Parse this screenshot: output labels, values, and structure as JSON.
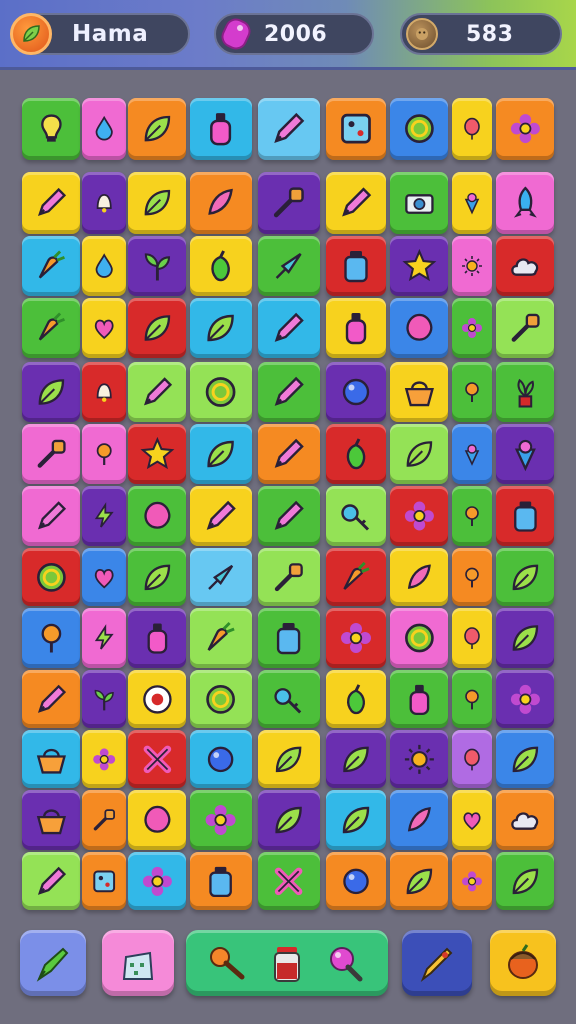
{
  "header": {
    "title": "Hama",
    "gems": "2006",
    "coins": "583",
    "colors": {
      "leaf_badge": "#f07a2a",
      "gem_badge": "#e04ad0",
      "coin_badge": "#8b6a40"
    }
  },
  "board": {
    "rows": [
      [
        [
          "green",
          "lightbulb"
        ],
        [
          "pink",
          "drop"
        ],
        [
          "orange",
          "leaf"
        ],
        [
          "cyan",
          "bottle"
        ],
        [
          "sky",
          "pencil"
        ],
        [
          "orange",
          "box"
        ],
        [
          "blue",
          "ring"
        ],
        [
          "yellow",
          "balloon"
        ],
        [
          "orange",
          "flower"
        ]
      ],
      [
        [
          "yellow",
          "pencil"
        ],
        [
          "purple",
          "bell"
        ],
        [
          "yellow",
          "leaf"
        ],
        [
          "orange",
          "feather"
        ],
        [
          "purple",
          "tool"
        ],
        [
          "yellow",
          "pencil"
        ],
        [
          "green",
          "camera"
        ],
        [
          "yellow",
          "cone"
        ],
        [
          "pink",
          "rocket"
        ]
      ],
      [
        [
          "cyan",
          "carrot"
        ],
        [
          "yellow",
          "drop"
        ],
        [
          "purple",
          "sprout"
        ],
        [
          "yellow",
          "pepper"
        ],
        [
          "green",
          "arrow"
        ],
        [
          "red",
          "jar"
        ],
        [
          "purple",
          "star"
        ],
        [
          "pink",
          "sun"
        ],
        [
          "red",
          "cloud"
        ]
      ],
      [
        [
          "green",
          "carrot"
        ],
        [
          "yellow",
          "heart"
        ],
        [
          "red",
          "leaf"
        ],
        [
          "cyan",
          "leaf"
        ],
        [
          "cyan",
          "pencil"
        ],
        [
          "yellow",
          "bottle"
        ],
        [
          "blue",
          "blob"
        ],
        [
          "green",
          "flower"
        ],
        [
          "lime",
          "tool"
        ]
      ],
      [
        [
          "purple",
          "leaf"
        ],
        [
          "red",
          "bell"
        ],
        [
          "lime",
          "pencil"
        ],
        [
          "lime",
          "ring"
        ],
        [
          "green",
          "pencil"
        ],
        [
          "purple",
          "ball"
        ],
        [
          "yellow",
          "basket"
        ],
        [
          "green",
          "pin"
        ],
        [
          "green",
          "plant"
        ]
      ],
      [
        [
          "pink",
          "tool"
        ],
        [
          "pink",
          "pin"
        ],
        [
          "red",
          "star"
        ],
        [
          "cyan",
          "leaf"
        ],
        [
          "orange",
          "pencil"
        ],
        [
          "red",
          "pepper"
        ],
        [
          "lime",
          "leaf"
        ],
        [
          "blue",
          "cone"
        ],
        [
          "purple",
          "cone"
        ]
      ],
      [
        [
          "pink",
          "pencil"
        ],
        [
          "purple",
          "bolt"
        ],
        [
          "green",
          "blob"
        ],
        [
          "yellow",
          "pencil"
        ],
        [
          "green",
          "pencil"
        ],
        [
          "lime",
          "key"
        ],
        [
          "red",
          "flower"
        ],
        [
          "green",
          "pin"
        ],
        [
          "red",
          "jar"
        ]
      ],
      [
        [
          "red",
          "ring"
        ],
        [
          "blue",
          "heart"
        ],
        [
          "green",
          "leaf"
        ],
        [
          "sky",
          "arrow"
        ],
        [
          "lime",
          "tool"
        ],
        [
          "red",
          "carrot"
        ],
        [
          "yellow",
          "feather"
        ],
        [
          "orange",
          "pin"
        ],
        [
          "green",
          "leaf"
        ]
      ],
      [
        [
          "blue",
          "pin"
        ],
        [
          "pink",
          "bolt"
        ],
        [
          "purple",
          "bottle"
        ],
        [
          "lime",
          "carrot"
        ],
        [
          "green",
          "jar"
        ],
        [
          "red",
          "flower"
        ],
        [
          "pink",
          "ring"
        ],
        [
          "yellow",
          "balloon"
        ],
        [
          "purple",
          "leaf"
        ]
      ],
      [
        [
          "orange",
          "pencil"
        ],
        [
          "purple",
          "sprout"
        ],
        [
          "yellow",
          "dot"
        ],
        [
          "lime",
          "ring"
        ],
        [
          "green",
          "key"
        ],
        [
          "yellow",
          "pepper"
        ],
        [
          "green",
          "bottle"
        ],
        [
          "green",
          "pin"
        ],
        [
          "purple",
          "flower"
        ]
      ],
      [
        [
          "cyan",
          "basket"
        ],
        [
          "yellow",
          "flower"
        ],
        [
          "red",
          "cross"
        ],
        [
          "cyan",
          "ball"
        ],
        [
          "yellow",
          "leaf"
        ],
        [
          "purple",
          "leaf"
        ],
        [
          "purple",
          "sun"
        ],
        [
          "lavender",
          "balloon"
        ],
        [
          "blue",
          "leaf"
        ]
      ],
      [
        [
          "purple",
          "basket"
        ],
        [
          "orange",
          "tool"
        ],
        [
          "yellow",
          "blob"
        ],
        [
          "green",
          "flower"
        ],
        [
          "purple",
          "leaf"
        ],
        [
          "cyan",
          "leaf"
        ],
        [
          "blue",
          "feather"
        ],
        [
          "yellow",
          "heart"
        ],
        [
          "orange",
          "cloud"
        ]
      ],
      [
        [
          "lime",
          "pencil"
        ],
        [
          "orange",
          "box"
        ],
        [
          "cyan",
          "flower"
        ],
        [
          "orange",
          "jar"
        ],
        [
          "green",
          "cross"
        ],
        [
          "orange",
          "ball"
        ],
        [
          "orange",
          "leaf"
        ],
        [
          "orange",
          "flower"
        ],
        [
          "green",
          "leaf"
        ]
      ]
    ],
    "palette": {
      "green": "#4cbf3a",
      "pink": "#f06ad2",
      "orange": "#f58a22",
      "cyan": "#32b8e8",
      "sky": "#67c8f2",
      "yellow": "#f7d21e",
      "purple": "#6a2fb0",
      "red": "#d82a2a",
      "blue": "#3b86e8",
      "lime": "#94e256",
      "lavender": "#b06be3"
    }
  },
  "dock": {
    "buttons": [
      "brush-tool",
      "bag-shop",
      "hammer-jar-mushroom",
      "pen-tool",
      "acorn-bonus"
    ],
    "colors": [
      "#7b8fe8",
      "#f58ad8",
      "#38c47a",
      "#3c4fb8",
      "#f7c21e"
    ]
  }
}
